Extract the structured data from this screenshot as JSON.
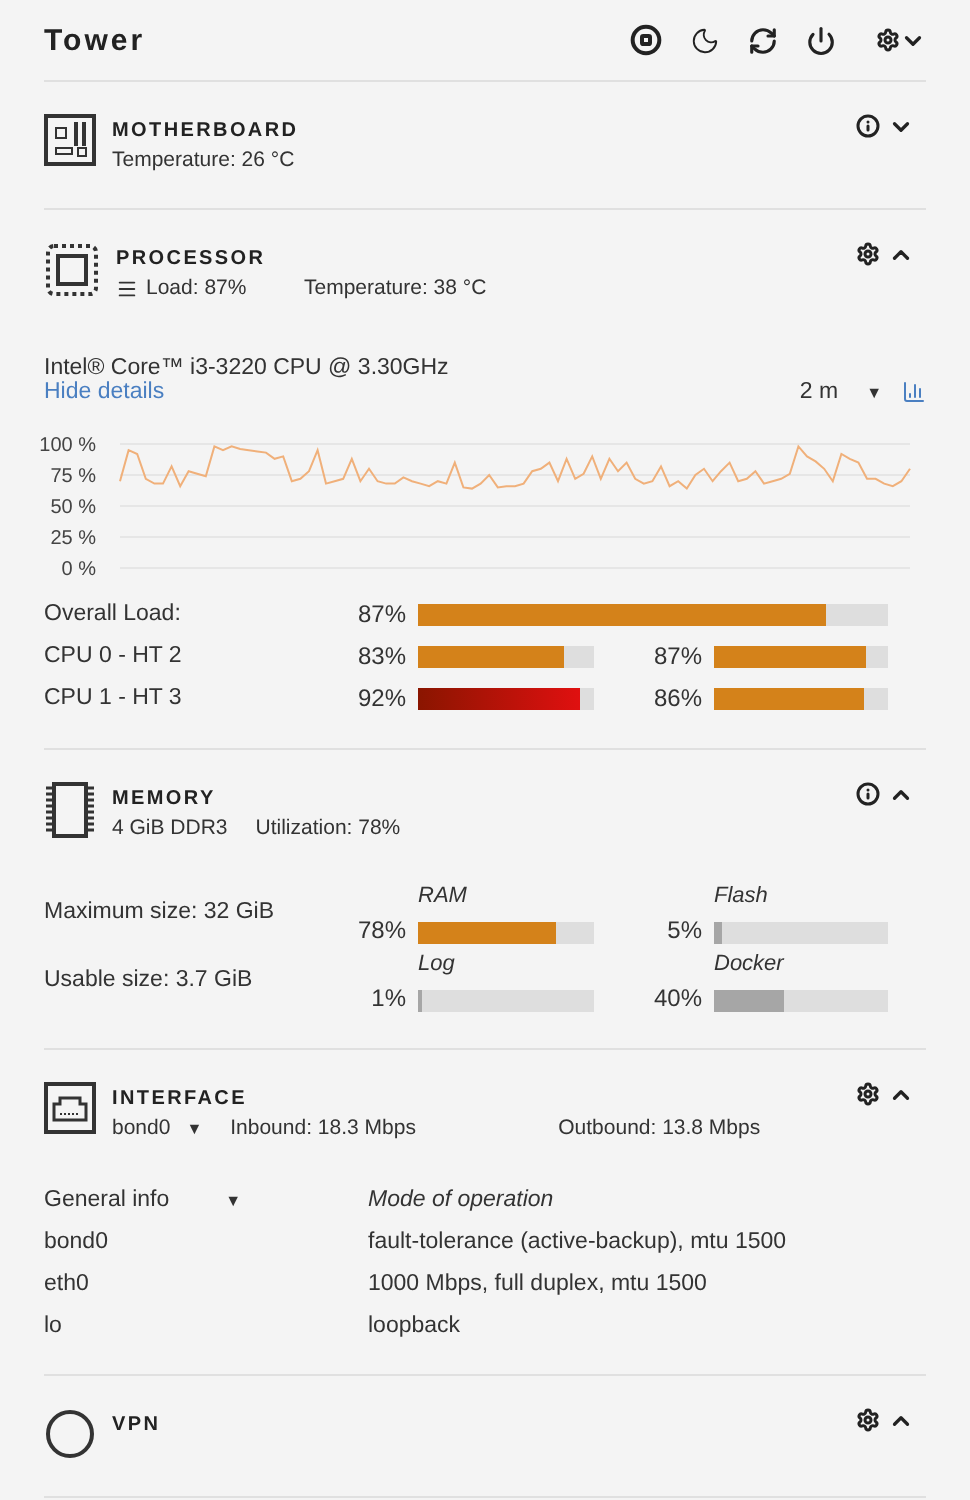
{
  "header": {
    "title": "Tower"
  },
  "sections": [
    {
      "kind": "motherboard",
      "title": "MOTHERBOARD",
      "expanded": false,
      "stats": [
        {
          "kind": "plain",
          "text": "Temperature: 26 °C"
        }
      ]
    },
    {
      "kind": "processor",
      "title": "PROCESSOR",
      "expanded": true,
      "stats": [
        {
          "kind": "menu",
          "text": "Load: 87%"
        },
        {
          "kind": "plain",
          "text": "Temperature: 38 °C"
        }
      ],
      "model": "Intel® Core™ i3-3220 CPU @ 3.30GHz",
      "toggle": "Hide details",
      "range": "2 m",
      "range_caret": "▼",
      "chart_data": {
        "type": "line",
        "grid": true,
        "ylim": [
          0,
          100
        ],
        "yticks": [
          {
            "value": 100,
            "label": "100 %"
          },
          {
            "value": 75,
            "label": "75 %"
          },
          {
            "value": 50,
            "label": "50 %"
          },
          {
            "value": 25,
            "label": "25 %"
          },
          {
            "value": 0,
            "label": "0 %"
          }
        ],
        "series": [
          {
            "color": "#f0b07a",
            "values": [
              70,
              95,
              92,
              72,
              68,
              68,
              82,
              66,
              78,
              76,
              74,
              98,
              95,
              98,
              96,
              95,
              94,
              93,
              88,
              90,
              70,
              72,
              78,
              95,
              68,
              70,
              72,
              88,
              70,
              80,
              70,
              68,
              68,
              73,
              70,
              68,
              66,
              70,
              68,
              85,
              65,
              64,
              68,
              75,
              65,
              66,
              66,
              68,
              78,
              80,
              85,
              70,
              88,
              72,
              76,
              90,
              72,
              88,
              78,
              85,
              72,
              68,
              70,
              82,
              66,
              70,
              64,
              75,
              80,
              70,
              78,
              85,
              70,
              72,
              78,
              68,
              70,
              72,
              76,
              98,
              90,
              86,
              80,
              70,
              92,
              88,
              85,
              72,
              72,
              68,
              66,
              70,
              80
            ]
          }
        ]
      },
      "overall": {
        "label": "Overall Load:",
        "reading": "87%",
        "level": 0.87
      },
      "cores": [
        {
          "label": "CPU 0 - HT 2",
          "threads": [
            {
              "reading": "83%",
              "level": 0.83,
              "critical": false
            },
            {
              "reading": "87%",
              "level": 0.87,
              "critical": false
            }
          ]
        },
        {
          "label": "CPU 1 - HT 3",
          "threads": [
            {
              "reading": "92%",
              "level": 0.92,
              "critical": true
            },
            {
              "reading": "86%",
              "level": 0.86,
              "critical": false
            }
          ]
        }
      ]
    },
    {
      "kind": "memory",
      "title": "MEMORY",
      "expanded": true,
      "stats": [
        {
          "kind": "plain",
          "text": "4 GiB DDR3"
        },
        {
          "kind": "plain",
          "text": "Utilization: 78%"
        }
      ],
      "rows": [
        {
          "label": "Maximum size: 32 GiB",
          "bars": [
            {
              "name": "RAM",
              "reading": "78%",
              "level": 0.78,
              "color": "#d4821a"
            },
            {
              "name": "Flash",
              "reading": "5%",
              "level": 0.05,
              "color": "#a6a6a6"
            }
          ]
        },
        {
          "label": "Usable size: 3.7 GiB",
          "bars": [
            {
              "name": "Log",
              "reading": "1%",
              "level": 0.01,
              "color": "#a6a6a6"
            },
            {
              "name": "Docker",
              "reading": "40%",
              "level": 0.4,
              "color": "#a6a6a6"
            }
          ]
        }
      ]
    },
    {
      "kind": "interface",
      "title": "INTERFACE",
      "expanded": true,
      "stats": [
        {
          "kind": "select",
          "text": "bond0",
          "caret": "▼"
        },
        {
          "kind": "plain",
          "text": "Inbound: 18.3 Mbps"
        },
        {
          "kind": "plain",
          "text": "Outbound: 13.8 Mbps"
        }
      ],
      "table": {
        "select": "General info",
        "caret": "▼",
        "heading": "Mode of operation",
        "rows": [
          [
            "bond0",
            "fault-tolerance (active-backup), mtu 1500"
          ],
          [
            "eth0",
            "1000 Mbps, full duplex, mtu 1500"
          ],
          [
            "lo",
            "loopback"
          ]
        ]
      }
    },
    {
      "kind": "vpn",
      "title": "VPN",
      "expanded": true
    }
  ]
}
